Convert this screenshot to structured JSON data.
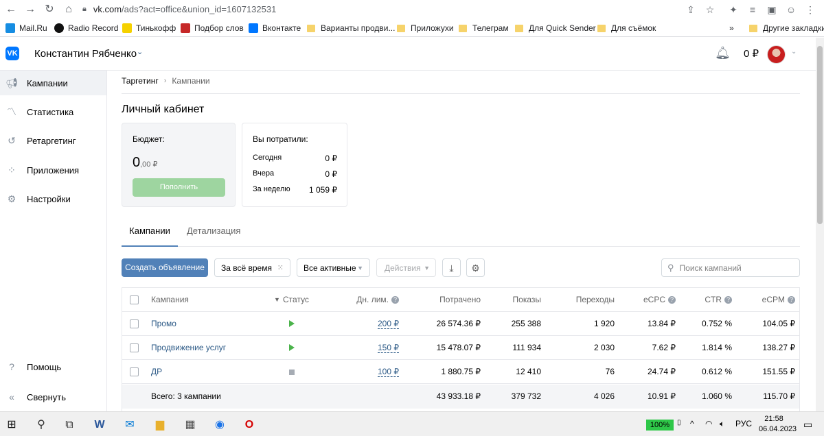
{
  "browser": {
    "url_host": "vk.com",
    "url_path": "/ads?act=office&union_id=1607132531",
    "bookmarks": [
      "Mail.Ru",
      "Radio Record",
      "Тинькофф",
      "Подбор слов",
      "Вконтакте",
      "Варианты продви...",
      "Приложухи",
      "Телеграм",
      "Для Quick Sender",
      "Для съёмок"
    ],
    "other_bookmarks": "Другие закладки",
    "more": "»"
  },
  "header": {
    "logo": "VK",
    "account_name": "Константин Рябченко",
    "balance": "0 ₽"
  },
  "sidebar": {
    "items": [
      {
        "label": "Кампании",
        "icon": "megaphone-icon"
      },
      {
        "label": "Статистика",
        "icon": "chart-icon"
      },
      {
        "label": "Ретаргетинг",
        "icon": "retarget-icon"
      },
      {
        "label": "Приложения",
        "icon": "apps-icon"
      },
      {
        "label": "Настройки",
        "icon": "gear-icon"
      }
    ],
    "help": "Помощь",
    "collapse": "Свернуть"
  },
  "breadcrumb": {
    "root": "Таргетинг",
    "current": "Кампании"
  },
  "page_title": "Личный кабинет",
  "budget": {
    "title": "Бюджет:",
    "amount_int": "0",
    "amount_frac": ",00 ₽",
    "topup_label": "Пополнить"
  },
  "spent": {
    "title": "Вы потратили:",
    "rows": [
      {
        "label": "Сегодня",
        "value": "0 ₽"
      },
      {
        "label": "Вчера",
        "value": "0 ₽"
      },
      {
        "label": "За неделю",
        "value": "1 059 ₽"
      }
    ]
  },
  "tabs": [
    "Кампании",
    "Детализация"
  ],
  "toolbar": {
    "create_ad": "Создать объявление",
    "period": "За всё время",
    "filter": "Все активные",
    "actions": "Действия",
    "search_placeholder": "Поиск кампаний"
  },
  "table": {
    "headers": {
      "campaign": "Кампания",
      "status": "Статус",
      "daily_limit": "Дн. лим.",
      "spent": "Потрачено",
      "impressions": "Показы",
      "clicks": "Переходы",
      "ecpc": "eCPC",
      "ctr": "CTR",
      "ecpm": "eCPM"
    },
    "rows": [
      {
        "name": "Промо",
        "status": "running",
        "limit": "200 ₽",
        "spent": "26 574.36 ₽",
        "impressions": "255 388",
        "clicks": "1 920",
        "ecpc": "13.84 ₽",
        "ctr": "0.752 %",
        "ecpm": "104.05 ₽"
      },
      {
        "name": "Продвижение услуг",
        "status": "running",
        "limit": "150 ₽",
        "spent": "15 478.07 ₽",
        "impressions": "111 934",
        "clicks": "2 030",
        "ecpc": "7.62 ₽",
        "ctr": "1.814 %",
        "ecpm": "138.27 ₽"
      },
      {
        "name": "ДР",
        "status": "stopped",
        "limit": "100 ₽",
        "spent": "1 880.75 ₽",
        "impressions": "12 410",
        "clicks": "76",
        "ecpc": "24.74 ₽",
        "ctr": "0.612 %",
        "ecpm": "151.55 ₽"
      }
    ],
    "total": {
      "label": "Всего: 3 кампании",
      "spent": "43 933.18 ₽",
      "impressions": "379 732",
      "clicks": "4 026",
      "ecpc": "10.91 ₽",
      "ctr": "1.060 %",
      "ecpm": "115.70 ₽"
    }
  },
  "taskbar": {
    "battery": "100%",
    "lang": "РУС",
    "time": "21:58",
    "date": "06.04.2023"
  },
  "colors": {
    "vk_blue": "#0077ff",
    "primary_button": "#5181b8",
    "link": "#2a5885",
    "status_running": "#4bb34b",
    "topup_disabled": "#9ed5a0"
  }
}
